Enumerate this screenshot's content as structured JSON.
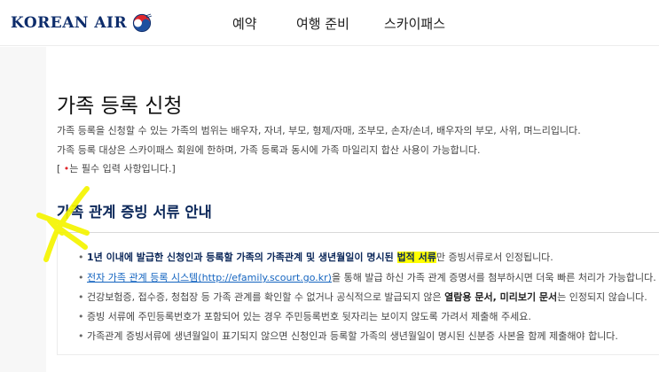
{
  "brand": {
    "logo_text": "KOREAN AIR",
    "accent": "#0b2759",
    "highlight": "#ffff00",
    "link": "#1565c0",
    "required": "#e0262b"
  },
  "nav": {
    "items": [
      {
        "label": "예약"
      },
      {
        "label": "여행 준비"
      },
      {
        "label": "스카이패스"
      }
    ]
  },
  "page": {
    "title": "가족 등록 신청",
    "desc_line1": "가족 등록을 신청할 수 있는 가족의 범위는 배우자, 자녀, 부모, 형제/자매, 조부모, 손자/손녀, 배우자의 부모, 사위, 며느리입니다.",
    "desc_line2": "가족 등록 대상은 스카이패스 회원에 한하며, 가족 등록과 동시에 가족 마일리지 합산 사용이 가능합니다.",
    "required_open": "[ ",
    "required_mark": "•",
    "required_close": "는 필수 입력 사항입니다.]"
  },
  "section": {
    "title": "가족 관계 증빙 서류 안내",
    "items": [
      {
        "bullet": "•",
        "strong": "1년 이내에 발급한 신청인과 등록할 가족의 가족관계 및 생년월일이 명시된 ",
        "highlight": "법적 서류",
        "rest": "만 증빙서류로서 인정됩니다."
      },
      {
        "bullet": "•",
        "link": "전자 가족 관계 등록 시스템(http://efamily.scourt.go.kr)",
        "rest": "을 통해 발급 하신 가족 관계 증명서를 첨부하시면 더욱 빠른 처리가 가능합니다."
      },
      {
        "bullet": "•",
        "pre": "건강보험증, 접수증, 청첩장 등 가족 관계를 확인할 수 없거나 공식적으로 발급되지 않은 ",
        "bold": "열람용 문서, 미리보기 문서",
        "rest": "는 인정되지 않습니다."
      },
      {
        "bullet": "•",
        "text": "증빙 서류에 주민등록번호가 포함되어 있는 경우 주민등록번호 뒷자리는 보이지 않도록 가려서 제출해 주세요."
      },
      {
        "bullet": "•",
        "text": "가족관계 증빙서류에 생년월일이 표기되지 않으면 신청인과 등록할 가족의 생년월일이 명시된 신분증 사본을 함께 제출해야 합니다."
      }
    ]
  }
}
